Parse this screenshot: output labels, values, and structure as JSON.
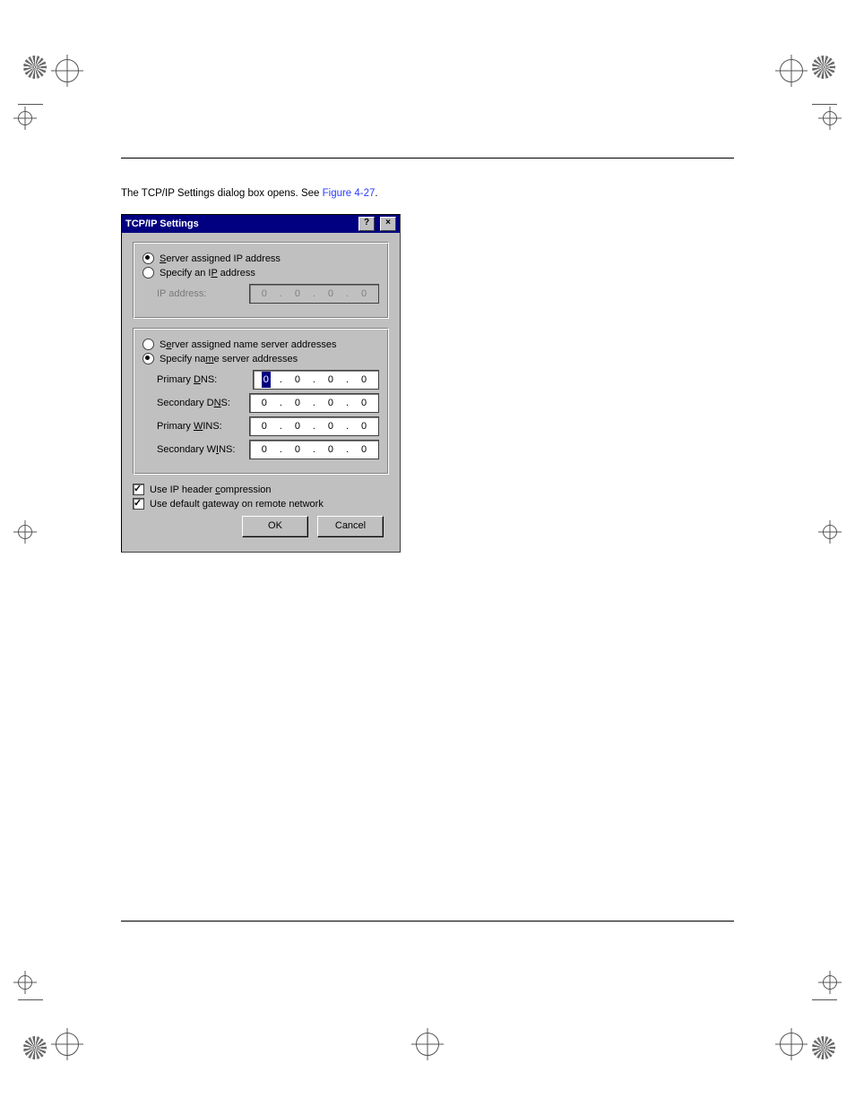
{
  "page": {
    "header_left": "",
    "header_right": "",
    "footer_left": "",
    "footer_right": "",
    "instruction_pre": "The TCP/IP Settings dialog box opens. See ",
    "instruction_link": "Figure 4-27",
    "instruction_post": "."
  },
  "dialog": {
    "title": "TCP/IP Settings",
    "btn_help": "?",
    "btn_close": "×",
    "group1": {
      "opt_server_ip_pre": "S",
      "opt_server_ip": "erver assigned IP address",
      "opt_specify_ip_pre": "Specify an I",
      "opt_specify_ip_ul": "P",
      "opt_specify_ip_post": " address",
      "ipaddr_label": "IP address:",
      "ipaddr_oct": [
        "0",
        "0",
        "0",
        "0"
      ]
    },
    "group2": {
      "opt_server_ns_pre": "S",
      "opt_server_ns_ul": "e",
      "opt_server_ns_post": "rver assigned name server addresses",
      "opt_specify_ns_pre": "Specify na",
      "opt_specify_ns_ul": "m",
      "opt_specify_ns_post": "e server addresses",
      "rows": [
        {
          "label_pre": "Primary ",
          "label_ul": "D",
          "label_post": "NS:",
          "oct": [
            "0",
            "0",
            "0",
            "0"
          ],
          "first_selected": true
        },
        {
          "label_pre": "Secondary D",
          "label_ul": "N",
          "label_post": "S:",
          "oct": [
            "0",
            "0",
            "0",
            "0"
          ],
          "first_selected": false
        },
        {
          "label_pre": "Primary ",
          "label_ul": "W",
          "label_post": "INS:",
          "oct": [
            "0",
            "0",
            "0",
            "0"
          ],
          "first_selected": false
        },
        {
          "label_pre": "Secondary W",
          "label_ul": "I",
          "label_post": "NS:",
          "oct": [
            "0",
            "0",
            "0",
            "0"
          ],
          "first_selected": false
        }
      ]
    },
    "chk_compress_pre": "Use IP header ",
    "chk_compress_ul": "c",
    "chk_compress_post": "ompression",
    "chk_gateway_pre": "Use default ",
    "chk_gateway_ul": "g",
    "chk_gateway_post": "ateway on remote network",
    "ok": "OK",
    "cancel": "Cancel"
  }
}
